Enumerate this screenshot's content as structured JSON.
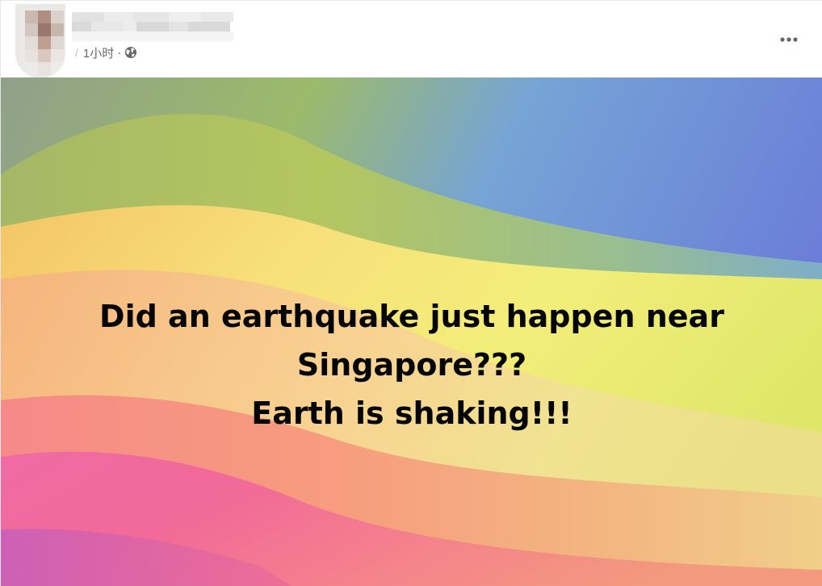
{
  "post": {
    "author": {
      "name": "",
      "avatar": "blurred-avatar"
    },
    "meta": {
      "timestamp": "1小时",
      "separator": "·",
      "audience_icon": "globe-icon"
    },
    "more_icon": "more-horizontal-icon",
    "text_lines": [
      "Did an earthquake just happen near",
      "Singapore???",
      "Earth is shaking!!!"
    ],
    "colors": {
      "text": "#050505",
      "meta_text": "#65676b",
      "background_gradient": [
        "#7fa0a0",
        "#a6c45a",
        "#6aa3e0",
        "#f2e36a",
        "#f6b37a",
        "#f26aa0",
        "#c95fb2"
      ]
    }
  }
}
